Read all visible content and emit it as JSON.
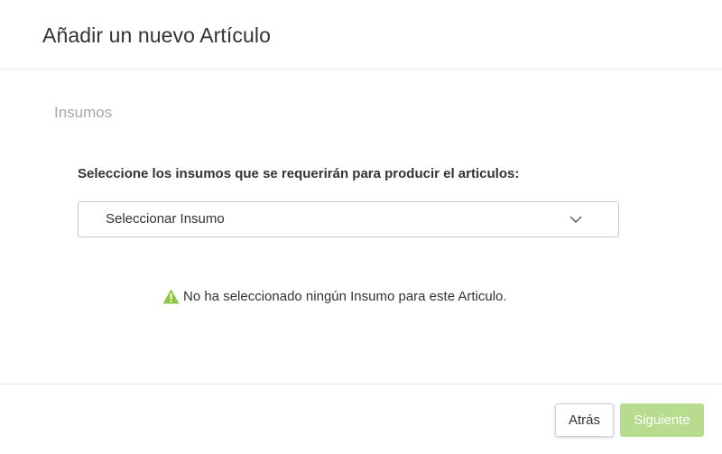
{
  "dialog": {
    "title": "Añadir un nuevo Artículo"
  },
  "step": {
    "section_title": "Insumos",
    "prompt": "Seleccione los insumos que se requerirán para producir el articulos:"
  },
  "insumo_select": {
    "selected_value": "Seleccionar Insumo",
    "icon": "chevron-down-icon"
  },
  "notice": {
    "icon": "warning-icon",
    "icon_color": "#8dc63f",
    "text": "No ha seleccionado ningún Insumo para este Articulo."
  },
  "footer": {
    "back_label": "Atrás",
    "next_label": "Siguiente",
    "next_color": "#b7dc8e"
  }
}
